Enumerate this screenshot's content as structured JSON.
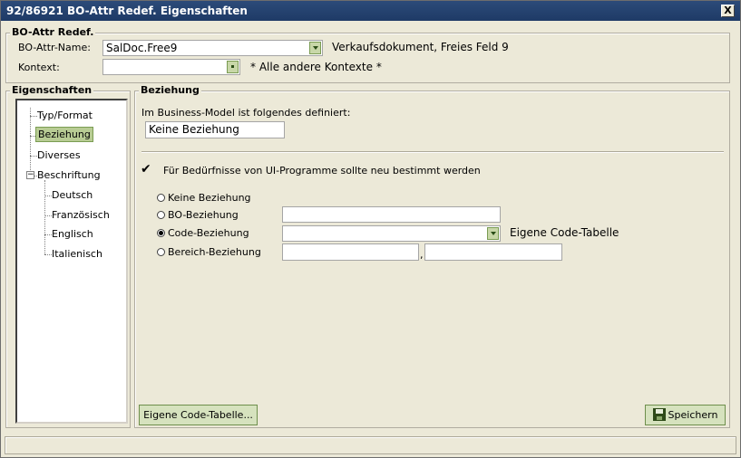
{
  "window": {
    "title": "92/86921 BO-Attr Redef. Eigenschaften",
    "close_label": "X"
  },
  "attr_group": {
    "legend": "BO-Attr Redef.",
    "name_label": "BO-Attr-Name:",
    "name_value": "SalDoc.Free9",
    "name_description": "Verkaufsdokument, Freies Feld 9",
    "context_label": "Kontext:",
    "context_value": "",
    "context_description": "* Alle andere Kontexte *"
  },
  "properties": {
    "legend": "Eigenschaften",
    "tree": [
      {
        "label": "Typ/Format"
      },
      {
        "label": "Beziehung"
      },
      {
        "label": "Diverses"
      },
      {
        "label": "Beschriftung",
        "expander": "−"
      },
      {
        "label": "Deutsch"
      },
      {
        "label": "Französisch"
      },
      {
        "label": "Englisch"
      },
      {
        "label": "Italienisch"
      }
    ],
    "selected": "Beziehung"
  },
  "relation": {
    "legend": "Beziehung",
    "bm_label": "Im Business-Model ist folgendes definiert:",
    "bm_value": "Keine Beziehung",
    "redefine_label": "Für Bedürfnisse von UI-Programme sollte neu bestimmt werden",
    "redefine_checked": true,
    "options": [
      {
        "label": "Keine Beziehung",
        "selected": false
      },
      {
        "label": "BO-Beziehung",
        "selected": false,
        "value": ""
      },
      {
        "label": "Code-Beziehung",
        "selected": true,
        "value": "",
        "description": "Eigene Code-Tabelle"
      },
      {
        "label": "Bereich-Beziehung",
        "selected": false,
        "value_from": "",
        "separator": ",",
        "value_to": ""
      }
    ],
    "code_table_button": "Eigene Code-Tabelle...",
    "save_button": "Speichern"
  },
  "status": {
    "text": ""
  }
}
